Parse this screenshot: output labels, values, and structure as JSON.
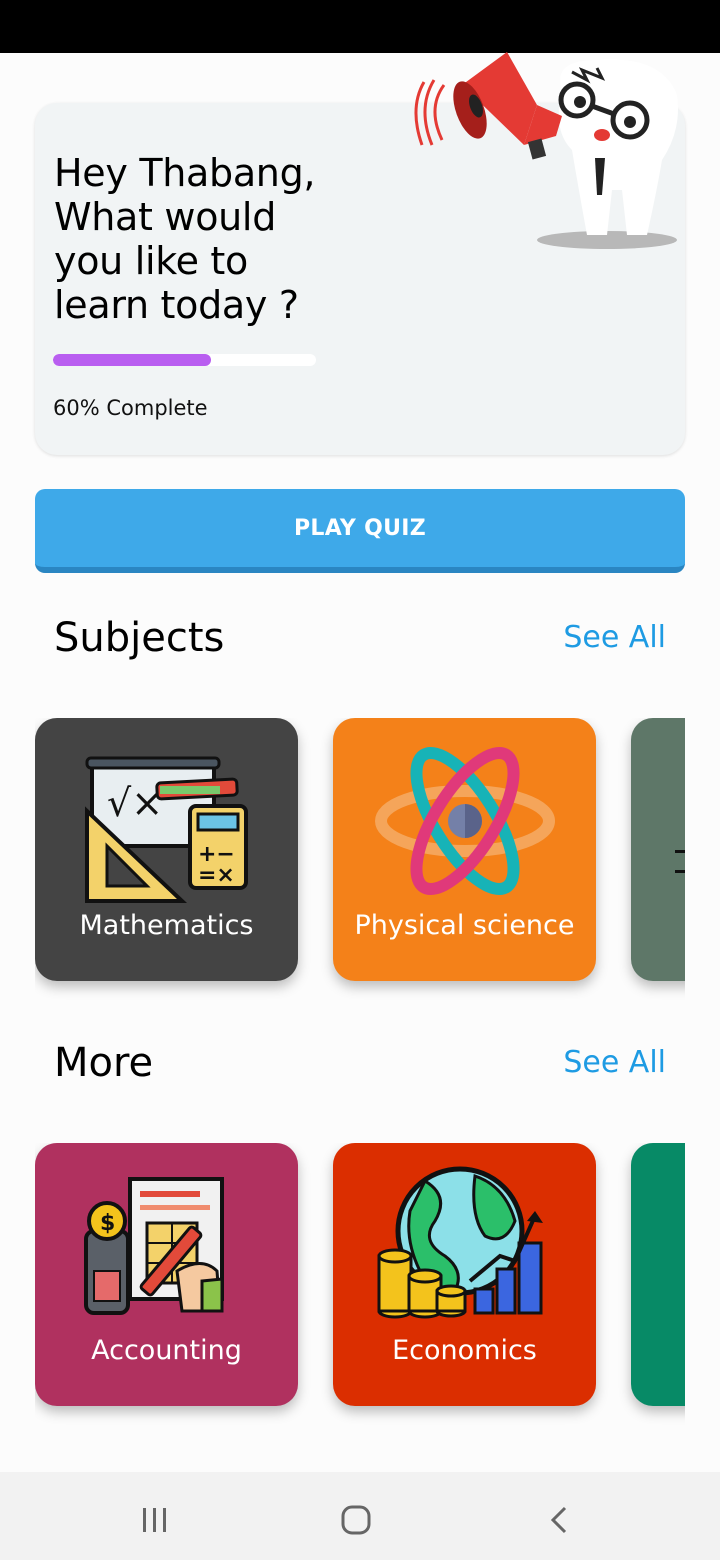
{
  "hero": {
    "greeting": "Hey Thabang, What would you like to learn today ?",
    "progress_value": 0.6,
    "progress_label": "60% Complete"
  },
  "play_quiz": {
    "label": "PLAY QUIZ"
  },
  "subjects": {
    "title": "Subjects",
    "see_all": "See All",
    "items": [
      {
        "label": "Mathematics",
        "color": "#444444",
        "icon": "math-tools-icon"
      },
      {
        "label": "Physical science",
        "color": "#f48119",
        "icon": "atom-icon"
      },
      {
        "label": "",
        "color": "#5e7768",
        "icon": "partial-card"
      }
    ]
  },
  "more": {
    "title": "More",
    "see_all": "See All",
    "items": [
      {
        "label": "Accounting",
        "color": "#b0315f",
        "icon": "accounting-icon"
      },
      {
        "label": "Economics",
        "color": "#db2e00",
        "icon": "economics-icon"
      },
      {
        "label": "",
        "color": "#078a66",
        "icon": "partial-card"
      }
    ]
  },
  "nav": {
    "icons": [
      "recent-apps-icon",
      "home-icon",
      "back-icon"
    ]
  }
}
